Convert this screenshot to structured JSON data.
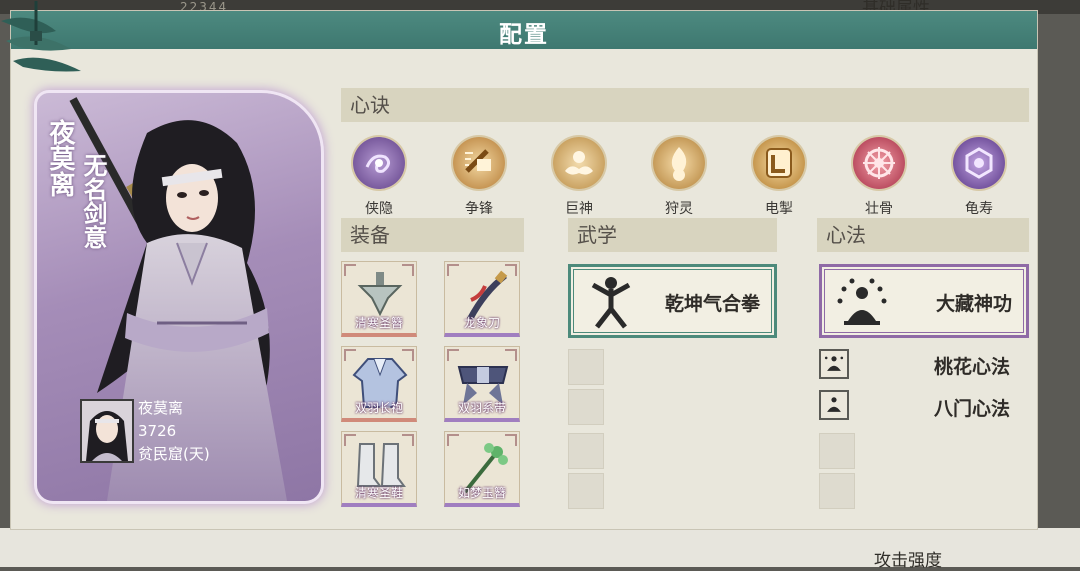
{
  "window": {
    "title": "配置"
  },
  "background": {
    "peek_left": "22344",
    "peek_right": "基础属性",
    "peek_bottom": "攻击强度"
  },
  "character": {
    "name": "夜莫离",
    "title": "无名剑意",
    "power": "3726",
    "origin": "贫民窟(天)"
  },
  "sections": {
    "heart_skills": "心诀",
    "equipment": "装备",
    "martial_arts": "武学",
    "methods": "心法"
  },
  "heart_skills": [
    {
      "label": "侠隐",
      "icon": "shadow-swirl-icon",
      "color": "#8a68b0"
    },
    {
      "label": "争锋",
      "icon": "fist-strike-icon",
      "color": "#c9954a"
    },
    {
      "label": "巨神",
      "icon": "cloud-giant-icon",
      "color": "#c9954a"
    },
    {
      "label": "狩灵",
      "icon": "spirit-flame-icon",
      "color": "#c9954a"
    },
    {
      "label": "电掣",
      "icon": "lightning-icon",
      "color": "#c9954a"
    },
    {
      "label": "壮骨",
      "icon": "red-wheel-icon",
      "color": "#c0475e"
    },
    {
      "label": "龟寿",
      "icon": "purple-shell-icon",
      "color": "#7a55a8"
    }
  ],
  "equipment": [
    {
      "label": "清寒圣簪",
      "icon": "hairpin-icon",
      "rarity": "red"
    },
    {
      "label": "龙象刀",
      "icon": "saber-icon",
      "rarity": "purple"
    },
    {
      "label": "双羽长袍",
      "icon": "robe-icon",
      "rarity": "red"
    },
    {
      "label": "双羽系带",
      "icon": "belt-icon",
      "rarity": "purple"
    },
    {
      "label": "清寒圣鞋",
      "icon": "boots-icon",
      "rarity": "purple"
    },
    {
      "label": "如梦玉簪",
      "icon": "jade-hairpin-icon",
      "rarity": "purple"
    }
  ],
  "martial_arts": {
    "main": {
      "label": "乾坤气合拳",
      "icon": "fighter-pose-icon"
    }
  },
  "methods": {
    "main": {
      "label": "大藏神功",
      "icon": "meditating-monk-icon"
    },
    "list": [
      {
        "label": "桃花心法",
        "icon": "lotus-meditation-icon"
      },
      {
        "label": "八门心法",
        "icon": "meditation-icon"
      }
    ]
  },
  "colors": {
    "title_bar": "#3e7870",
    "panel": "#e9e7dc",
    "section_header": "#d8d4bf",
    "card_purple": "#a58db8"
  }
}
